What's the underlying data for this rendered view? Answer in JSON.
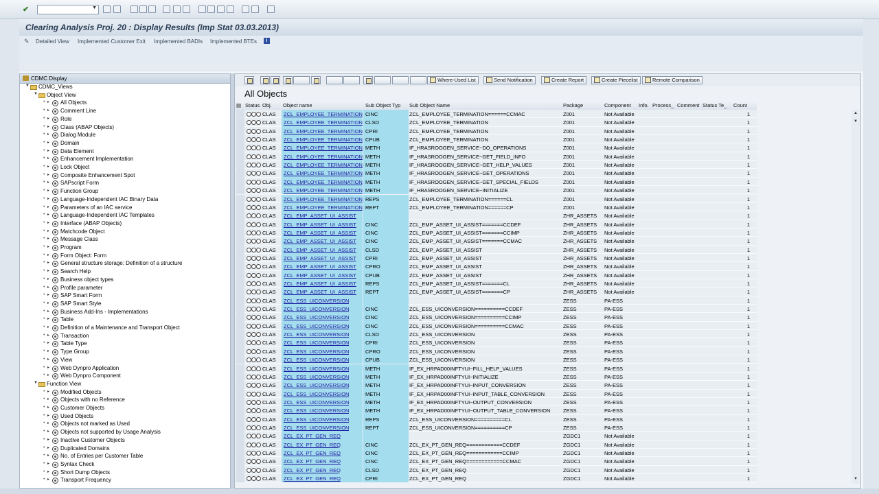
{
  "title": "Clearing Analysis Proj. 20 : Display Results (Imp Stat 03.03.2013)",
  "app_toolbar": [
    "Detailed View",
    "Implemented Customer Exit",
    "Implemented BADIs",
    "Implemented BTEs"
  ],
  "tree": {
    "root": "CDMC Display",
    "views": "CDMC_Views",
    "object_view": "Object View",
    "object_items": [
      "All Objects",
      "Comment Line",
      "Role",
      "Class (ABAP Objects)",
      "Dialog Module",
      "Domain",
      "Data Element",
      "Enhancement Implementation",
      "Lock Object",
      "Composite Enhancement Spot",
      "SAPscript Form",
      "Function Group",
      "Language-Independent IAC Binary Data",
      "Parameters of an IAC service",
      "Language-Independent IAC Templates",
      "Interface (ABAP Objects)",
      "Matchcode Object",
      "Message Class",
      "Program",
      "Form Object: Form",
      "General structure storage: Definition of a structure",
      "Search Help",
      "Business object types",
      "Profile parameter",
      "SAP Smart Form",
      "SAP Smart Style",
      "Business Add-Ins - Implementations",
      "Table",
      "Definition of a Maintenance and Transport Object",
      "Transaction",
      "Table Type",
      "Type Group",
      "View",
      "Web Dynpro Application",
      "Web Dynpro Component"
    ],
    "function_view": "Function View",
    "function_items": [
      "Modified Objects",
      "Objects with no Reference",
      "Customer Objects",
      "Used Objects",
      "Objects not marked as Used",
      "Objects not supported by Usage Analysis",
      "Inactive Customer Objects",
      "Duplicated Domains",
      "No. of Entries per Customer Table",
      "Syntax Check",
      "Short Dump Objects",
      "Transport Frequency"
    ]
  },
  "grid_toolbar": {
    "where_used": "Where-Used List",
    "send_notification": "Send Notification",
    "create_report": "Create Report",
    "create_piecelist": "Create Piecelist",
    "remote_comparison": "Remote Comparison"
  },
  "grid_title": "All Objects",
  "columns": [
    "Status",
    "Obj.",
    "Object name",
    "Sub Object Typ",
    "Sub Object Name",
    "Package",
    "Component",
    "Info.",
    "Process_",
    "Comment",
    "Status Te_",
    "Count"
  ],
  "rows": [
    [
      "CLAS",
      "ZCL_EMPLOYEE_TERMINATION",
      "CINC",
      "ZCL_EMPLOYEE_TERMINATION======CCMAC",
      "Z001",
      "Not Available",
      "1"
    ],
    [
      "CLAS",
      "ZCL_EMPLOYEE_TERMINATION",
      "CLSD",
      "ZCL_EMPLOYEE_TERMINATION",
      "Z001",
      "Not Available",
      "1"
    ],
    [
      "CLAS",
      "ZCL_EMPLOYEE_TERMINATION",
      "CPRI",
      "ZCL_EMPLOYEE_TERMINATION",
      "Z001",
      "Not Available",
      "1"
    ],
    [
      "CLAS",
      "ZCL_EMPLOYEE_TERMINATION",
      "CPUB",
      "ZCL_EMPLOYEE_TERMINATION",
      "Z001",
      "Not Available",
      "1"
    ],
    [
      "CLAS",
      "ZCL_EMPLOYEE_TERMINATION",
      "METH",
      "IF_HRASROOGEN_SERVICE~DO_OPERATIONS",
      "Z001",
      "Not Available",
      "1"
    ],
    [
      "CLAS",
      "ZCL_EMPLOYEE_TERMINATION",
      "METH",
      "IF_HRASROOGEN_SERVICE~GET_FIELD_INFO",
      "Z001",
      "Not Available",
      "1"
    ],
    [
      "CLAS",
      "ZCL_EMPLOYEE_TERMINATION",
      "METH",
      "IF_HRASROOGEN_SERVICE~GET_HELP_VALUES",
      "Z001",
      "Not Available",
      "1"
    ],
    [
      "CLAS",
      "ZCL_EMPLOYEE_TERMINATION",
      "METH",
      "IF_HRASROOGEN_SERVICE~GET_OPERATIONS",
      "Z001",
      "Not Available",
      "1"
    ],
    [
      "CLAS",
      "ZCL_EMPLOYEE_TERMINATION",
      "METH",
      "IF_HRASROOGEN_SERVICE~GET_SPECIAL_FIELDS",
      "Z001",
      "Not Available",
      "1"
    ],
    [
      "CLAS",
      "ZCL_EMPLOYEE_TERMINATION",
      "METH",
      "IF_HRASROOGEN_SERVICE~INITIALIZE",
      "Z001",
      "Not Available",
      "1"
    ],
    [
      "CLAS",
      "ZCL_EMPLOYEE_TERMINATION",
      "REPS",
      "ZCL_EMPLOYEE_TERMINATION======CL",
      "Z001",
      "Not Available",
      "1"
    ],
    [
      "CLAS",
      "ZCL_EMPLOYEE_TERMINATION",
      "REPT",
      "ZCL_EMPLOYEE_TERMINATION======CP",
      "Z001",
      "Not Available",
      "1"
    ],
    [
      "CLAS",
      "ZCL_EMP_ASSET_UI_ASSIST",
      "",
      "",
      "ZHR_ASSETS",
      "Not Available",
      "1"
    ],
    [
      "CLAS",
      "ZCL_EMP_ASSET_UI_ASSIST",
      "CINC",
      "ZCL_EMP_ASSET_UI_ASSIST=======CCDEF",
      "ZHR_ASSETS",
      "Not Available",
      "1"
    ],
    [
      "CLAS",
      "ZCL_EMP_ASSET_UI_ASSIST",
      "CINC",
      "ZCL_EMP_ASSET_UI_ASSIST=======CCIMP",
      "ZHR_ASSETS",
      "Not Available",
      "1"
    ],
    [
      "CLAS",
      "ZCL_EMP_ASSET_UI_ASSIST",
      "CINC",
      "ZCL_EMP_ASSET_UI_ASSIST=======CCMAC",
      "ZHR_ASSETS",
      "Not Available",
      "1"
    ],
    [
      "CLAS",
      "ZCL_EMP_ASSET_UI_ASSIST",
      "CLSD",
      "ZCL_EMP_ASSET_UI_ASSIST",
      "ZHR_ASSETS",
      "Not Available",
      "1"
    ],
    [
      "CLAS",
      "ZCL_EMP_ASSET_UI_ASSIST",
      "CPRI",
      "ZCL_EMP_ASSET_UI_ASSIST",
      "ZHR_ASSETS",
      "Not Available",
      "1"
    ],
    [
      "CLAS",
      "ZCL_EMP_ASSET_UI_ASSIST",
      "CPRO",
      "ZCL_EMP_ASSET_UI_ASSIST",
      "ZHR_ASSETS",
      "Not Available",
      "1"
    ],
    [
      "CLAS",
      "ZCL_EMP_ASSET_UI_ASSIST",
      "CPUB",
      "ZCL_EMP_ASSET_UI_ASSIST",
      "ZHR_ASSETS",
      "Not Available",
      "1"
    ],
    [
      "CLAS",
      "ZCL_EMP_ASSET_UI_ASSIST",
      "REPS",
      "ZCL_EMP_ASSET_UI_ASSIST=======CL",
      "ZHR_ASSETS",
      "Not Available",
      "1"
    ],
    [
      "CLAS",
      "ZCL_EMP_ASSET_UI_ASSIST",
      "REPT",
      "ZCL_EMP_ASSET_UI_ASSIST=======CP",
      "ZHR_ASSETS",
      "Not Available",
      "1"
    ],
    [
      "CLAS",
      "ZCL_ESS_UICONVERSION",
      "",
      "",
      "ZESS",
      "PA-ESS",
      "1"
    ],
    [
      "CLAS",
      "ZCL_ESS_UICONVERSION",
      "CINC",
      "ZCL_ESS_UICONVERSION==========CCDEF",
      "ZESS",
      "PA-ESS",
      "1"
    ],
    [
      "CLAS",
      "ZCL_ESS_UICONVERSION",
      "CINC",
      "ZCL_ESS_UICONVERSION==========CCIMP",
      "ZESS",
      "PA-ESS",
      "1"
    ],
    [
      "CLAS",
      "ZCL_ESS_UICONVERSION",
      "CINC",
      "ZCL_ESS_UICONVERSION==========CCMAC",
      "ZESS",
      "PA-ESS",
      "1"
    ],
    [
      "CLAS",
      "ZCL_ESS_UICONVERSION",
      "CLSD",
      "ZCL_ESS_UICONVERSION",
      "ZESS",
      "PA-ESS",
      "1"
    ],
    [
      "CLAS",
      "ZCL_ESS_UICONVERSION",
      "CPRI",
      "ZCL_ESS_UICONVERSION",
      "ZESS",
      "PA-ESS",
      "1"
    ],
    [
      "CLAS",
      "ZCL_ESS_UICONVERSION",
      "CPRO",
      "ZCL_ESS_UICONVERSION",
      "ZESS",
      "PA-ESS",
      "1"
    ],
    [
      "CLAS",
      "ZCL_ESS_UICONVERSION",
      "CPUB",
      "ZCL_ESS_UICONVERSION",
      "ZESS",
      "PA-ESS",
      "1"
    ],
    [
      "CLAS",
      "ZCL_ESS_UICONVERSION",
      "METH",
      "IF_EX_HRPAD00INFTYUI~FILL_HELP_VALUES",
      "ZESS",
      "PA-ESS",
      "1"
    ],
    [
      "CLAS",
      "ZCL_ESS_UICONVERSION",
      "METH",
      "IF_EX_HRPAD00INFTYUI~INITIALIZE",
      "ZESS",
      "PA-ESS",
      "1"
    ],
    [
      "CLAS",
      "ZCL_ESS_UICONVERSION",
      "METH",
      "IF_EX_HRPAD00INFTYUI~INPUT_CONVERSION",
      "ZESS",
      "PA-ESS",
      "1"
    ],
    [
      "CLAS",
      "ZCL_ESS_UICONVERSION",
      "METH",
      "IF_EX_HRPAD00INFTYUI~INPUT_TABLE_CONVERSION",
      "ZESS",
      "PA-ESS",
      "1"
    ],
    [
      "CLAS",
      "ZCL_ESS_UICONVERSION",
      "METH",
      "IF_EX_HRPAD00INFTYUI~OUTPUT_CONVERSION",
      "ZESS",
      "PA-ESS",
      "1"
    ],
    [
      "CLAS",
      "ZCL_ESS_UICONVERSION",
      "METH",
      "IF_EX_HRPAD00INFTYUI~OUTPUT_TABLE_CONVERSION",
      "ZESS",
      "PA-ESS",
      "1"
    ],
    [
      "CLAS",
      "ZCL_ESS_UICONVERSION",
      "REPS",
      "ZCL_ESS_UICONVERSION==========CL",
      "ZESS",
      "PA-ESS",
      "1"
    ],
    [
      "CLAS",
      "ZCL_ESS_UICONVERSION",
      "REPT",
      "ZCL_ESS_UICONVERSION==========CP",
      "ZESS",
      "PA-ESS",
      "1"
    ],
    [
      "CLAS",
      "ZCL_EX_PT_GEN_REQ",
      "",
      "",
      "ZGDC1",
      "Not Available",
      "1"
    ],
    [
      "CLAS",
      "ZCL_EX_PT_GEN_REQ",
      "CINC",
      "ZCL_EX_PT_GEN_REQ============CCDEF",
      "ZGDC1",
      "Not Available",
      "1"
    ],
    [
      "CLAS",
      "ZCL_EX_PT_GEN_REQ",
      "CINC",
      "ZCL_EX_PT_GEN_REQ============CCIMP",
      "ZGDC1",
      "Not Available",
      "1"
    ],
    [
      "CLAS",
      "ZCL_EX_PT_GEN_REQ",
      "CINC",
      "ZCL_EX_PT_GEN_REQ============CCMAC",
      "ZGDC1",
      "Not Available",
      "1"
    ],
    [
      "CLAS",
      "ZCL_EX_PT_GEN_REQ",
      "CLSD",
      "ZCL_EX_PT_GEN_REQ",
      "ZGDC1",
      "Not Available",
      "1"
    ],
    [
      "CLAS",
      "ZCL_EX_PT_GEN_REQ",
      "CPRI",
      "ZCL_EX_PT_GEN_REQ",
      "ZGDC1",
      "Not Available",
      "1"
    ]
  ]
}
